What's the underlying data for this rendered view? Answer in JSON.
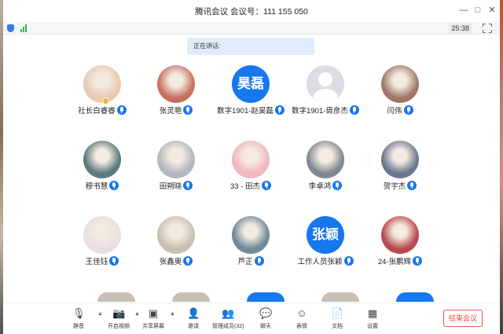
{
  "window": {
    "title": "腾讯会议 会议号：111 155 050"
  },
  "status": {
    "timer": "25:38"
  },
  "speaking": {
    "label": "正在讲话:"
  },
  "participants": [
    {
      "name": "社长白睿睿",
      "avatar": "photo-girl",
      "avatar_text": "",
      "host": true,
      "avatar_color": "#e8c8b0"
    },
    {
      "name": "张灵艳",
      "avatar": "photo-anime-girl",
      "avatar_text": "",
      "host": false,
      "avatar_color": "#c87060"
    },
    {
      "name": "数字1901-赵昊磊",
      "avatar": "text",
      "avatar_text": "昊磊",
      "host": false,
      "avatar_color": "#1677ee"
    },
    {
      "name": "数字1901-毋彦杰",
      "avatar": "default",
      "avatar_text": "",
      "host": false,
      "avatar_color": "#dadde2"
    },
    {
      "name": "闫伟",
      "avatar": "photo-child",
      "avatar_text": "",
      "host": false,
      "avatar_color": "#a07868"
    },
    {
      "name": "穆书慧",
      "avatar": "photo-anime",
      "avatar_text": "",
      "host": false,
      "avatar_color": "#5a7a80"
    },
    {
      "name": "田朔晓",
      "avatar": "photo-dog",
      "avatar_text": "",
      "host": false,
      "avatar_color": "#b0b8c0"
    },
    {
      "name": "33 - 田杰",
      "avatar": "photo-anime-pink",
      "avatar_text": "",
      "host": false,
      "avatar_color": "#f0b8c0"
    },
    {
      "name": "李卓鸿",
      "avatar": "photo-robot",
      "avatar_text": "",
      "host": false,
      "avatar_color": "#808890"
    },
    {
      "name": "贺宇杰",
      "avatar": "photo-sunset",
      "avatar_text": "",
      "host": false,
      "avatar_color": "#6a7890"
    },
    {
      "name": "王佳钰",
      "avatar": "photo-cartoon",
      "avatar_text": "",
      "host": false,
      "avatar_color": "#e8e0e0"
    },
    {
      "name": "张鑫奥",
      "avatar": "photo-boy",
      "avatar_text": "",
      "host": false,
      "avatar_color": "#c8c0b0"
    },
    {
      "name": "芦正",
      "avatar": "photo-sea",
      "avatar_text": "",
      "host": false,
      "avatar_color": "#708898"
    },
    {
      "name": "工作人员张颖",
      "avatar": "text",
      "avatar_text": "张颖",
      "host": false,
      "avatar_color": "#1677ee"
    },
    {
      "name": "24-张鹏辉",
      "avatar": "photo-red",
      "avatar_text": "",
      "host": false,
      "avatar_color": "#b84850"
    }
  ],
  "toolbar": {
    "mute": "静音",
    "video": "开启视频",
    "share": "共享屏幕",
    "invite": "邀请",
    "members": "管理成员(32)",
    "chat": "聊天",
    "reaction": "表情",
    "docs": "文档",
    "settings": "设置",
    "end": "结束会议"
  },
  "colors": {
    "accent": "#1677ee",
    "end_red": "#e0473c",
    "speaking_bg": "#e1ebfb"
  }
}
